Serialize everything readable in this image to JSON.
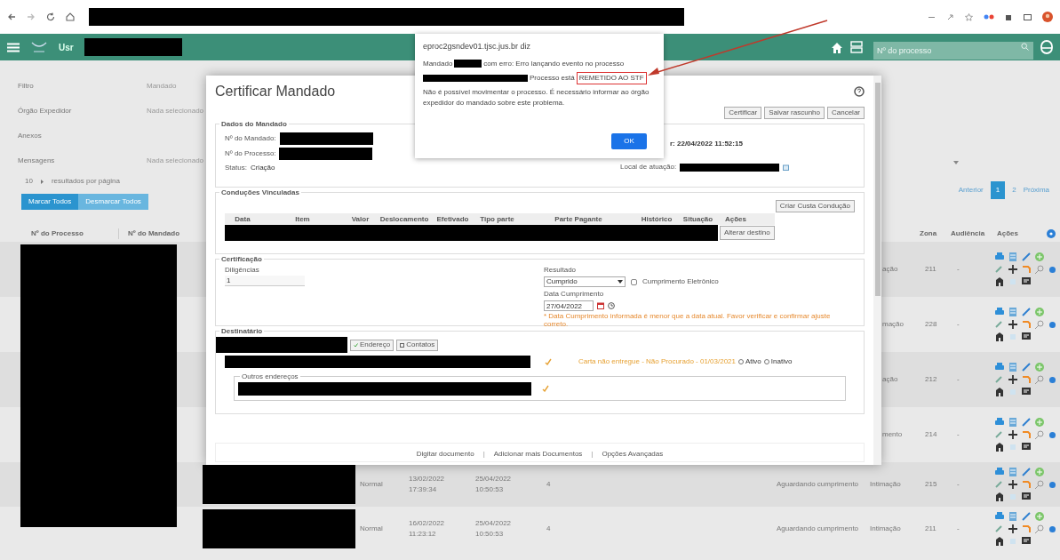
{
  "app_header": {
    "user_label": "Usr",
    "search": {
      "placeholder": "Nº do processo"
    }
  },
  "filters": [
    {
      "label": "Filtro",
      "value": "Mandado"
    },
    {
      "label": "Órgão Expedidor",
      "value": "Nada selecionado"
    },
    {
      "label": "Anexos"
    },
    {
      "label": "Mensagens",
      "value": "Nada selecionado"
    }
  ],
  "page_size": {
    "value": "10",
    "label": "resultados por página"
  },
  "bulk_buttons": [
    {
      "label": "Marcar Todos",
      "selected": true
    },
    {
      "label": "Desmarcar Todos",
      "selected": false
    }
  ],
  "pagination": [
    {
      "label": "Anterior",
      "selected": false
    },
    {
      "label": "1",
      "selected": true
    },
    {
      "label": "2",
      "selected": false
    },
    {
      "label": "Próxima",
      "selected": false
    }
  ],
  "table": {
    "columns_left": [
      "Nº do Processo",
      "Nº do Mandado"
    ],
    "columns_right": [
      "Zona",
      "Audiência",
      "Ações"
    ],
    "rows": [
      {
        "kind": "covered",
        "status": "ação",
        "zona": "211",
        "audiencia": "-"
      },
      {
        "kind": "covered",
        "status": "mação",
        "zona": "228",
        "audiencia": "-"
      },
      {
        "kind": "covered",
        "status": "ação",
        "zona": "212",
        "audiencia": "-"
      },
      {
        "kind": "covered",
        "status": "mento",
        "zona": "214",
        "audiencia": "-"
      },
      {
        "kind": "full",
        "urgencia": "Normal",
        "criado": [
          "13/02/2022",
          "17:39:34"
        ],
        "prazo": [
          "25/04/2022",
          "10:50:53"
        ],
        "count": "4",
        "status": "Aguardando cumprimento",
        "tipo": "Intimação",
        "zona": "215",
        "audiencia": "-"
      },
      {
        "kind": "full",
        "urgencia": "Normal",
        "criado": [
          "16/02/2022",
          "11:23:12"
        ],
        "prazo": [
          "25/04/2022",
          "10:50:53"
        ],
        "count": "4",
        "status": "Aguardando cumprimento",
        "tipo": "Intimação",
        "zona": "211",
        "audiencia": "-"
      }
    ]
  },
  "modal": {
    "title": "Certificar Mandado",
    "buttons": [
      "Certificar",
      "Salvar rascunho",
      "Cancelar"
    ],
    "dados": {
      "legend": "Dados do Mandado",
      "mandado_label": "Nº do Mandado:",
      "processo_label": "Nº do Processo:",
      "status_label": "Status:",
      "status_value": "Criação",
      "data_fragment": "r: 22/04/2022 11:52:15",
      "local_label": "Local de atuação:"
    },
    "conducoes": {
      "legend": "Conduções Vinculadas",
      "create_button": "Criar Custa Condução",
      "columns": [
        "Data",
        "Item",
        "Valor",
        "Deslocamento",
        "Efetivado",
        "Tipo parte",
        "Parte Pagante",
        "Histórico",
        "Situação",
        "Ações"
      ],
      "row_button": "Alterar destino"
    },
    "certificacao": {
      "legend": "Certificação",
      "diligencias_label": "Diligências",
      "diligencias_value": "1",
      "resultado_label": "Resultado",
      "resultado_value": "Cumprido",
      "eletronico": {
        "label": "Cumprimento Eletrônico",
        "checked": false
      },
      "data_label": "Data Cumprimento",
      "data_value": "27/04/2022",
      "warning": "* Data Cumprimento informada é menor que a data atual. Favor verificar e confirmar ajuste correto."
    },
    "destinatario": {
      "legend": "Destinatário",
      "buttons": [
        "Endereço",
        "Contatos"
      ],
      "address_note": "Carta não entregue - Não Procurado - 01/03/2021",
      "radios": [
        {
          "label": "Ativo",
          "selected": false
        },
        {
          "label": "Inativo",
          "selected": false
        }
      ],
      "outros_legend": "Outros endereços"
    },
    "footer": [
      {
        "kind": "link",
        "label": "Digitar documento"
      },
      {
        "kind": "separator",
        "label": "|"
      },
      {
        "kind": "link",
        "label": "Adicionar mais Documentos"
      },
      {
        "kind": "separator",
        "label": "|"
      },
      {
        "kind": "link",
        "label": "Opções Avançadas"
      }
    ]
  },
  "alert": {
    "origin": "eproc2gsndev01.tjsc.jus.br diz",
    "line1_a": "Mandado",
    "line1_b": "com erro: Erro lançando evento no processo",
    "line2_a": "Processo está",
    "highlight": "REMETIDO AO STF",
    "line3": "Não é possível movimentar o processo. É necessário informar ao órgão expedidor do mandado sobre este problema.",
    "ok": "OK"
  }
}
